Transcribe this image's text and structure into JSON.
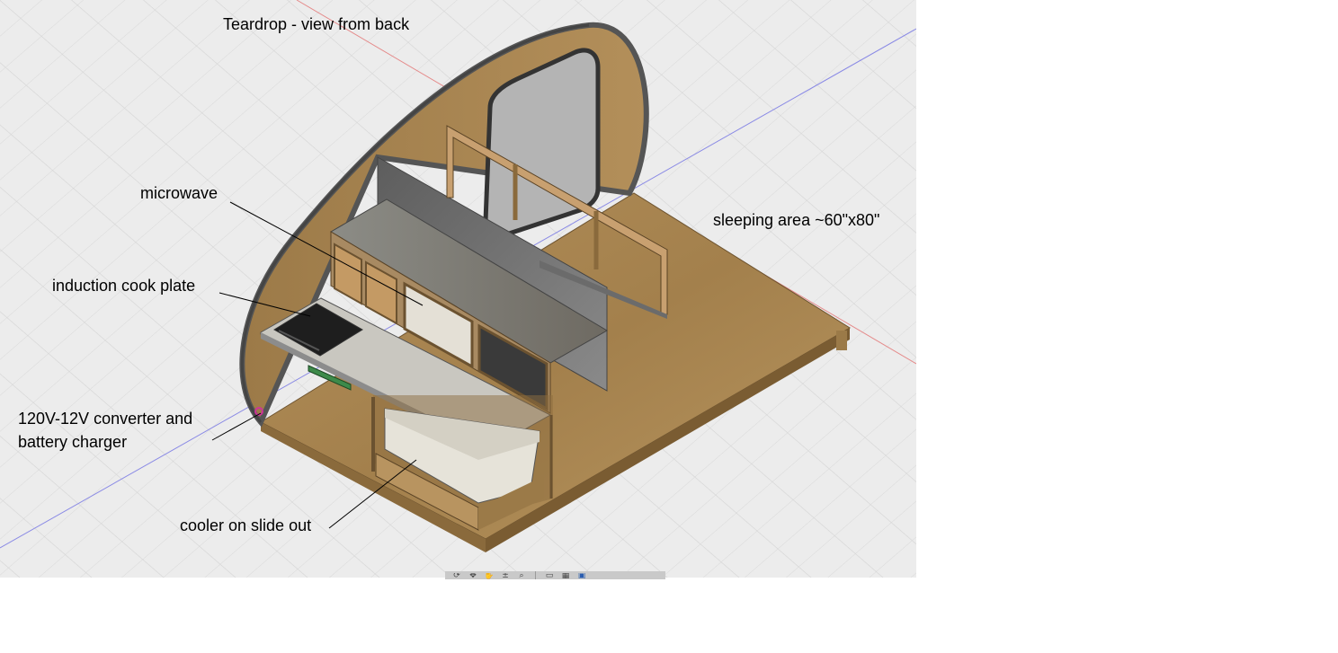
{
  "annotations": {
    "title": "Teardrop - view from back",
    "microwave": "microwave",
    "induction": "induction cook plate",
    "converter_line1": "120V-12V converter and",
    "converter_line2": "battery charger",
    "cooler": "cooler on slide out",
    "sleeping": "sleeping area ~60\"x80\""
  },
  "colors": {
    "viewport_bg": "#ececec",
    "grid": "#d2d2d2",
    "wood": "#a88654",
    "wood_dark": "#8a6a3c",
    "panel_gray": "#6f6f6f",
    "counter": "#c9c6bd",
    "axis_red": "#e07070",
    "axis_blue": "#7070e0"
  },
  "toolbar": {
    "icons": [
      "orbit-icon",
      "pan-icon",
      "hand-icon",
      "zoom-icon",
      "zoom-window-icon",
      "display-settings-icon",
      "grid-icon",
      "viewports-icon"
    ]
  }
}
